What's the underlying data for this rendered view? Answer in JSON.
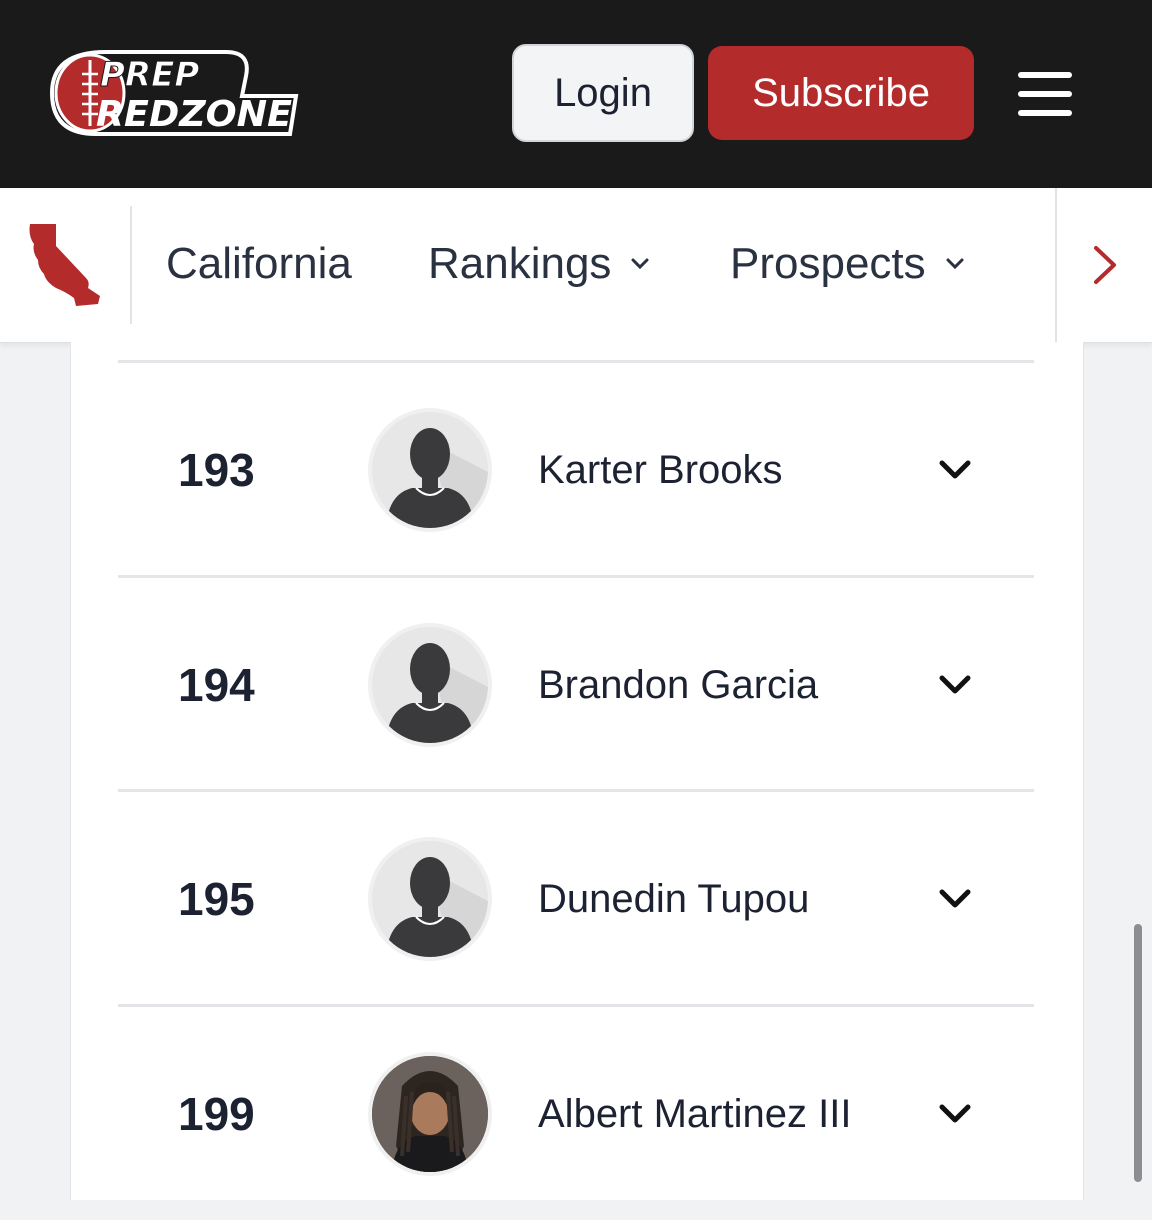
{
  "header": {
    "logo_line1": "PREP",
    "logo_line2": "REDZONE",
    "login_label": "Login",
    "subscribe_label": "Subscribe",
    "menu_icon": "hamburger-icon"
  },
  "subnav": {
    "state_icon": "california-map-icon",
    "items": [
      {
        "label": "California"
      },
      {
        "label": "Rankings"
      },
      {
        "label": "Prospects"
      }
    ],
    "next_icon": "chevron-right-icon"
  },
  "colors": {
    "header_bg": "#1b1a1a",
    "brand_red": "#b32b2b",
    "text_dark": "#1c2231"
  },
  "rankings": [
    {
      "rank": "193",
      "name": "Karter Brooks",
      "avatar": "placeholder-silhouette"
    },
    {
      "rank": "194",
      "name": "Brandon Garcia",
      "avatar": "placeholder-silhouette"
    },
    {
      "rank": "195",
      "name": "Dunedin Tupou",
      "avatar": "placeholder-silhouette"
    },
    {
      "rank": "199",
      "name": "Albert Martinez III",
      "avatar": "player-photo"
    }
  ]
}
